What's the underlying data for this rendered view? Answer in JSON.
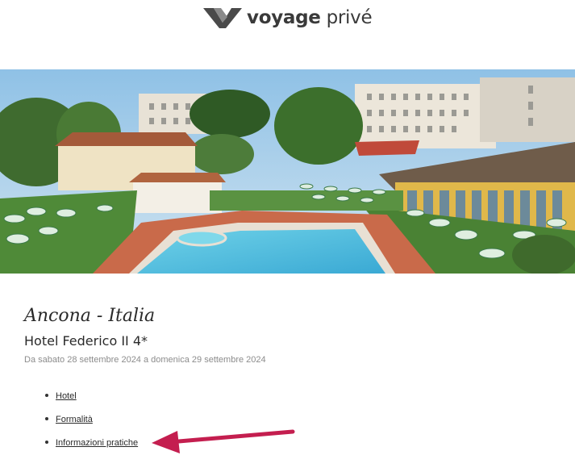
{
  "header": {
    "logo_text_bold": "voyage",
    "logo_text_light": "privé",
    "logo_icon": "voyage-prive-chevron-logo"
  },
  "hero": {
    "alt": "Hotel pool with green parasols and buildings"
  },
  "offer": {
    "destination": "Ancona - Italia",
    "hotel_name": "Hotel Federico II 4*",
    "dates": "Da sabato 28 settembre 2024 a domenica 29 settembre 2024"
  },
  "links": [
    {
      "label": "Hotel"
    },
    {
      "label": "Formalità"
    },
    {
      "label": "Informazioni pratiche"
    }
  ],
  "annotation": {
    "icon": "pointer-arrow",
    "color": "#c41e4f"
  }
}
